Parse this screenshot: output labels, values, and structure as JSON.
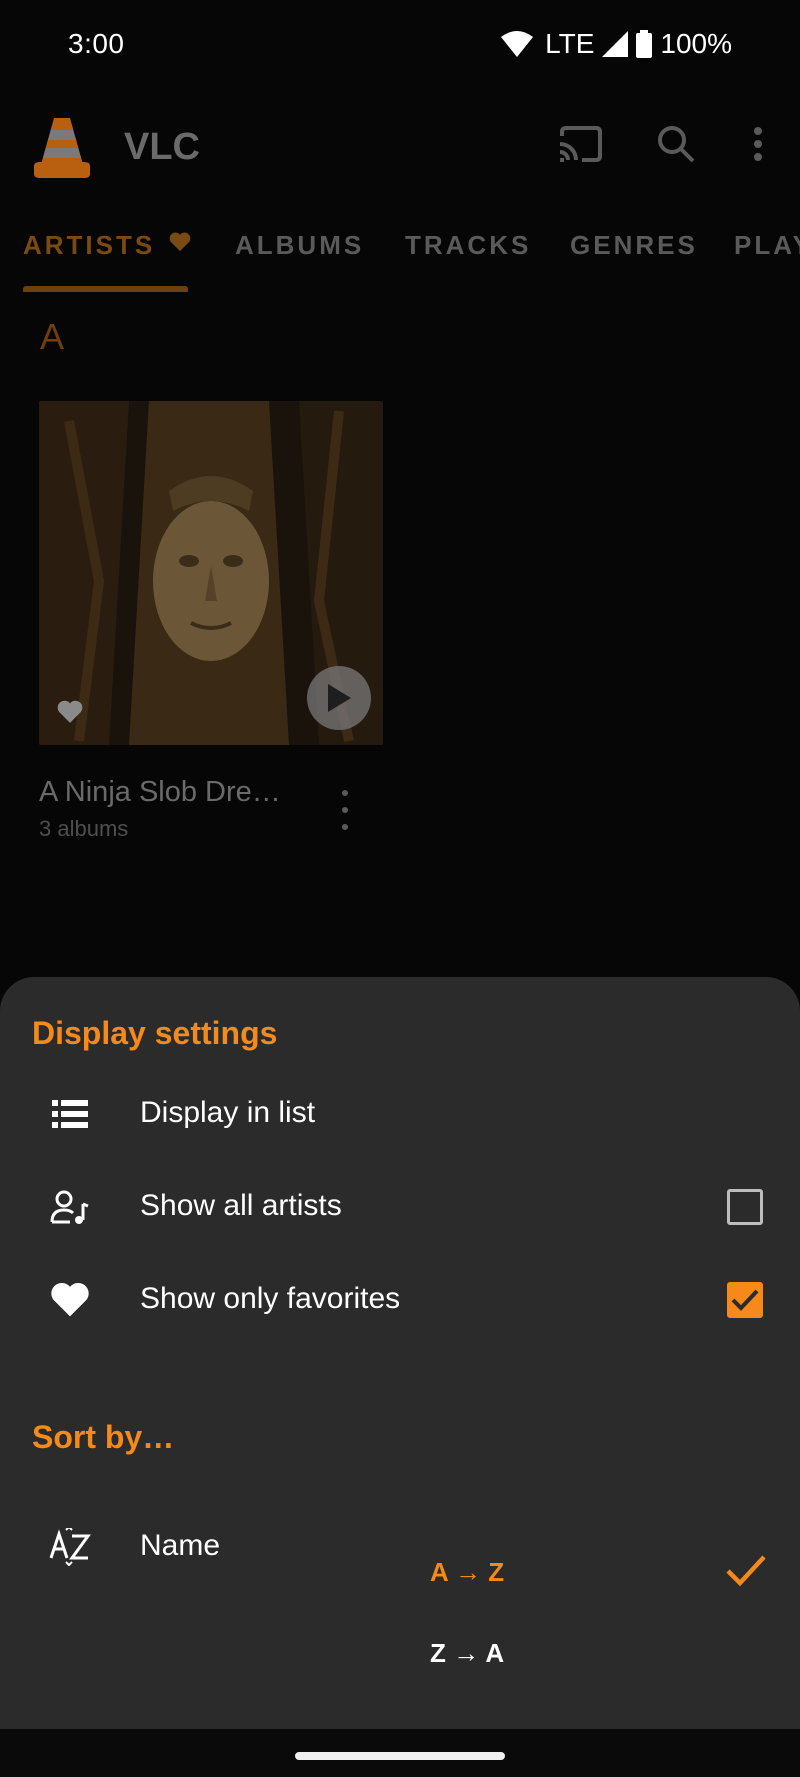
{
  "status": {
    "time": "3:00",
    "network": "LTE",
    "battery": "100%"
  },
  "app": {
    "title": "VLC",
    "actions": [
      "cast-icon",
      "search-icon",
      "more-vert-icon"
    ]
  },
  "tabs": [
    {
      "label": "ARTISTS",
      "active": true
    },
    {
      "label": "ALBUMS",
      "active": false
    },
    {
      "label": "TRACKS",
      "active": false
    },
    {
      "label": "GENRES",
      "active": false
    },
    {
      "label": "PLAYLISTS",
      "active": false
    }
  ],
  "library": {
    "section_letter": "A",
    "artists": [
      {
        "name": "A Ninja Slob Dre…",
        "subtitle": "3 albums",
        "favorite": true
      }
    ]
  },
  "sheet": {
    "display_heading": "Display settings",
    "display_items": [
      {
        "label": "Display in list",
        "icon": "list-icon"
      },
      {
        "label": "Show all artists",
        "icon": "artist-music-icon",
        "checked": false
      },
      {
        "label": "Show only favorites",
        "icon": "heart-icon",
        "checked": true
      }
    ],
    "sort_heading": "Sort by…",
    "sort_items": [
      {
        "label": "Name",
        "icon": "sort-az-icon",
        "asc_label": "A → Z",
        "desc_label": "Z → A",
        "selected": "asc"
      }
    ]
  },
  "colors": {
    "accent": "#f5891a",
    "sheet_bg": "#2b2b2b",
    "background": "#060606"
  }
}
